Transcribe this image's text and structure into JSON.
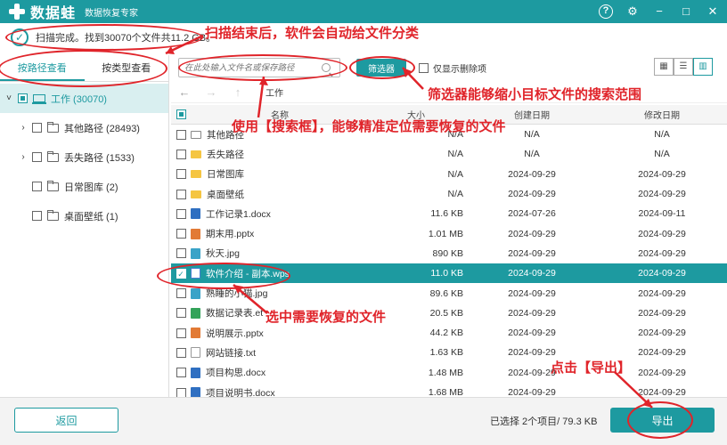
{
  "titlebar": {
    "app_name": "数据蛙",
    "subtitle": "数据恢复专家",
    "help": "?",
    "settings": "⚙",
    "minimize": "−",
    "maximize": "□",
    "close": "✕"
  },
  "status": {
    "text": "扫描完成。找到30070个文件共11.2 GB。"
  },
  "left": {
    "tabs": [
      {
        "label": "按路径查看",
        "active": true
      },
      {
        "label": "按类型查看",
        "active": false
      }
    ],
    "tree": [
      {
        "label": "工作 (30070)",
        "selected": true
      },
      {
        "label": "其他路径 (28493)"
      },
      {
        "label": "丢失路径 (1533)"
      },
      {
        "label": "日常图库 (2)"
      },
      {
        "label": "桌面壁纸 (1)"
      }
    ]
  },
  "toolbar": {
    "search_placeholder": "在此处输入文件名或保存路径",
    "filter_label": "筛选器",
    "deleted_only_label": "仅显示删除项",
    "view_grid": "▦",
    "view_list": "☰",
    "view_detail": "▥"
  },
  "nav": {
    "back": "←",
    "forward": "→",
    "up": "↑",
    "path": "工作"
  },
  "table": {
    "headers": {
      "name": "名称",
      "size": "大小",
      "created": "创建日期",
      "modified": "修改日期"
    },
    "rows": [
      {
        "name": "其他路径",
        "size": "N/A",
        "created": "N/A",
        "modified": "N/A",
        "icon": "folder-outline"
      },
      {
        "name": "丢失路径",
        "size": "N/A",
        "created": "N/A",
        "modified": "N/A",
        "icon": "folder"
      },
      {
        "name": "日常图库",
        "size": "N/A",
        "created": "2024-09-29",
        "modified": "2024-09-29",
        "icon": "folder"
      },
      {
        "name": "桌面壁纸",
        "size": "N/A",
        "created": "2024-09-29",
        "modified": "2024-09-29",
        "icon": "folder"
      },
      {
        "name": "工作记录1.docx",
        "size": "11.6 KB",
        "created": "2024-07-26",
        "modified": "2024-09-11",
        "icon": "docx"
      },
      {
        "name": "期末用.pptx",
        "size": "1.01 MB",
        "created": "2024-09-29",
        "modified": "2024-09-29",
        "icon": "pptx"
      },
      {
        "name": "秋天.jpg",
        "size": "890 KB",
        "created": "2024-09-29",
        "modified": "2024-09-29",
        "icon": "jpg"
      },
      {
        "name": "软件介绍 - 副本.wps",
        "size": "11.0 KB",
        "created": "2024-09-29",
        "modified": "2024-09-29",
        "icon": "wps",
        "selected": true
      },
      {
        "name": "熟睡的小猫.jpg",
        "size": "89.6 KB",
        "created": "2024-09-29",
        "modified": "2024-09-29",
        "icon": "jpg"
      },
      {
        "name": "数据记录表.et",
        "size": "20.5 KB",
        "created": "2024-09-29",
        "modified": "2024-09-29",
        "icon": "et"
      },
      {
        "name": "说明展示.pptx",
        "size": "44.2 KB",
        "created": "2024-09-29",
        "modified": "2024-09-29",
        "icon": "pptx"
      },
      {
        "name": "网站链接.txt",
        "size": "1.63 KB",
        "created": "2024-09-29",
        "modified": "2024-09-29",
        "icon": "txt"
      },
      {
        "name": "项目构思.docx",
        "size": "1.48 MB",
        "created": "2024-09-29",
        "modified": "2024-09-29",
        "icon": "docx"
      },
      {
        "name": "项目说明书.docx",
        "size": "1.68 MB",
        "created": "2024-09-29",
        "modified": "2024-09-29",
        "icon": "docx"
      }
    ]
  },
  "bottom": {
    "back_label": "返回",
    "selection_info": "已选择 2个项目/ 79.3 KB",
    "export_label": "导出"
  },
  "annotations": {
    "scan_done": "扫描结束后，软件会自动给文件分类",
    "filter": "筛选器能够缩小目标文件的搜索范围",
    "search": "使用【搜索框】，能够精准定位需要恢复的文件",
    "select": "选中需要恢复的文件",
    "export": "点击【导出】"
  },
  "colors": {
    "accent": "#1d9aa0",
    "annotation": "#e0242a"
  }
}
